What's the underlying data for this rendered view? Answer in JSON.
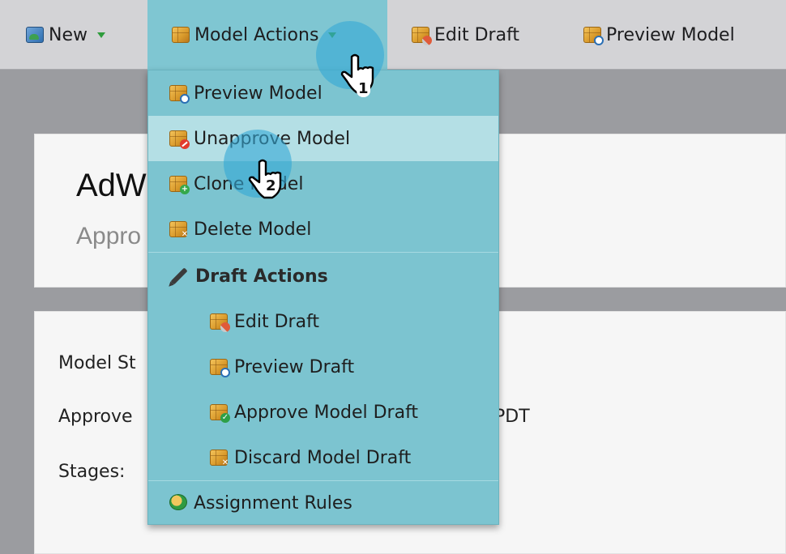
{
  "toolbar": {
    "new_label": "New",
    "model_actions_label": "Model Actions",
    "edit_draft_label": "Edit Draft",
    "preview_model_label": "Preview Model"
  },
  "page": {
    "title": "AdW",
    "subtitle": "Appro",
    "fields": {
      "model_status_label": "Model St",
      "approved_label": "Approve",
      "approved_time": "PDT",
      "stages_label": "Stages:"
    }
  },
  "menu": {
    "items": [
      {
        "label": "Preview Model",
        "icon": "preview-model-icon"
      },
      {
        "label": "Unapprove Model",
        "icon": "unapprove-model-icon",
        "hovered": true
      },
      {
        "label": "Clone Model",
        "icon": "clone-model-icon"
      },
      {
        "label": "Delete Model",
        "icon": "delete-model-icon"
      }
    ],
    "draft_header": "Draft Actions",
    "draft_items": [
      {
        "label": "Edit Draft",
        "icon": "edit-draft-icon"
      },
      {
        "label": "Preview Draft",
        "icon": "preview-draft-icon"
      },
      {
        "label": "Approve Model Draft",
        "icon": "approve-draft-icon"
      },
      {
        "label": "Discard Model Draft",
        "icon": "discard-draft-icon"
      }
    ],
    "assignment_rules": "Assignment Rules"
  },
  "annotations": {
    "step1": "1",
    "step2": "2"
  },
  "colors": {
    "menu_bg": "#7cc4d0",
    "menu_hover": "#b4dfe5",
    "toolbar_bg": "#d3d3d6",
    "cursor_marker": "#34a8d6"
  }
}
